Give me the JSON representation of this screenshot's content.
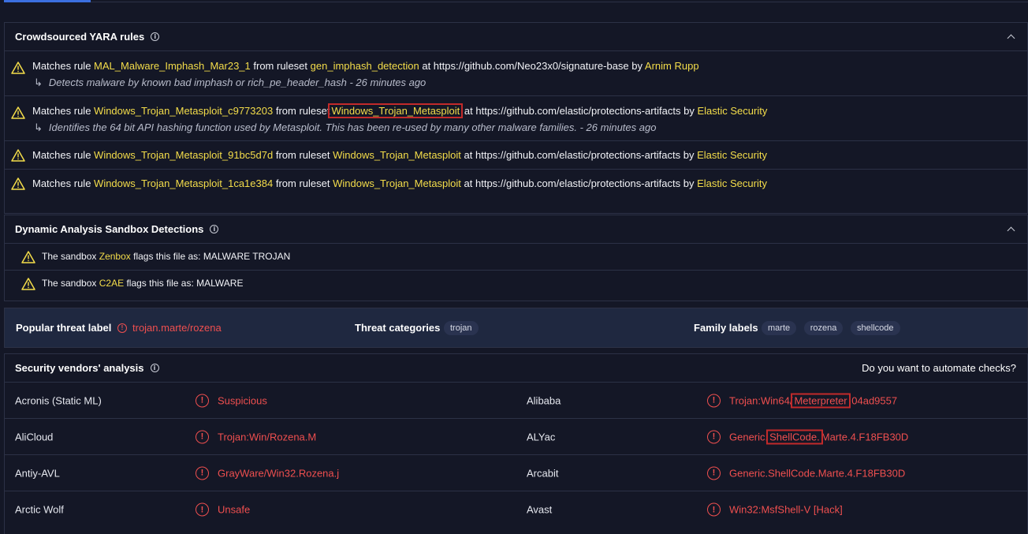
{
  "yara": {
    "title": "Crowdsourced YARA rules",
    "rows": [
      {
        "prefix": "Matches rule",
        "rule": "MAL_Malware_Imphash_Mar23_1",
        "from": "from ruleset",
        "ruleset": "gen_imphash_detection",
        "at": "at https://github.com/Neo23x0/signature-base by",
        "author": "Arnim Rupp",
        "description": "Detects malware by known bad imphash or rich_pe_header_hash - 26 minutes ago"
      },
      {
        "prefix": "Matches rule",
        "rule": "Windows_Trojan_Metasploit_c9773203",
        "from": "from ruleset",
        "ruleset": "Windows_Trojan_Metasploit",
        "at": "at https://github.com/elastic/protections-artifacts by",
        "author": "Elastic Security",
        "description": "Identifies the 64 bit API hashing function used by Metasploit. This has been re-used by many other malware families. - 26 minutes ago"
      },
      {
        "prefix": "Matches rule",
        "rule": "Windows_Trojan_Metasploit_91bc5d7d",
        "from": "from ruleset",
        "ruleset": "Windows_Trojan_Metasploit",
        "at": "at https://github.com/elastic/protections-artifacts by",
        "author": "Elastic Security"
      },
      {
        "prefix": "Matches rule",
        "rule": "Windows_Trojan_Metasploit_1ca1e384",
        "from": "from ruleset",
        "ruleset": "Windows_Trojan_Metasploit",
        "at": "at https://github.com/elastic/protections-artifacts by",
        "author": "Elastic Security"
      }
    ]
  },
  "sandbox": {
    "title": "Dynamic Analysis Sandbox Detections",
    "rows": [
      {
        "pre": "The sandbox",
        "name": "Zenbox",
        "post": "flags this file as: MALWARE TROJAN"
      },
      {
        "pre": "The sandbox",
        "name": "C2AE",
        "post": "flags this file as: MALWARE"
      }
    ]
  },
  "threat": {
    "popular_label": "Popular threat label",
    "popular_value": "trojan.marte/rozena",
    "categories_label": "Threat categories",
    "categories": [
      "trojan"
    ],
    "family_label": "Family labels",
    "families": [
      "marte",
      "rozena",
      "shellcode"
    ]
  },
  "vendors": {
    "title": "Security vendors' analysis",
    "automate": "Do you want to automate checks?",
    "rows": [
      {
        "v1": "Acronis (Static ML)",
        "r1": "Suspicious",
        "v2": "Alibaba",
        "r2a": "Trojan:Win64/",
        "r2b": "Meterpreter",
        "r2c": ".04ad9557"
      },
      {
        "v1": "AliCloud",
        "r1": "Trojan:Win/Rozena.M",
        "v2": "ALYac",
        "r2a": "Generic.",
        "r2b": "ShellCode.",
        "r2c": "Marte.4.F18FB30D"
      },
      {
        "v1": "Antiy-AVL",
        "r1": "GrayWare/Win32.Rozena.j",
        "v2": "Arcabit",
        "r2a": "Generic.ShellCode.Marte.4.F18FB30D",
        "r2b": "",
        "r2c": ""
      },
      {
        "v1": "Arctic Wolf",
        "r1": "Unsafe",
        "v2": "Avast",
        "r2a": "Win32:MsfShell-V [Hack]",
        "r2b": "",
        "r2c": ""
      }
    ]
  },
  "colors": {
    "highlight": "#f4dd4a",
    "malicious": "#ef4f4f",
    "accent": "#3b6fe0",
    "annotation": "#c22a2a"
  }
}
